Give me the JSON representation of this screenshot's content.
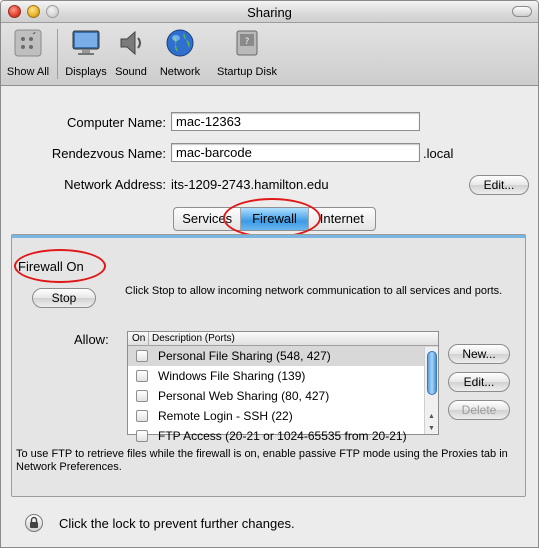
{
  "window": {
    "title": "Sharing"
  },
  "toolbar": {
    "items": [
      {
        "label": "Show All",
        "icon": "apple-icon"
      },
      {
        "label": "Displays",
        "icon": "display-icon"
      },
      {
        "label": "Sound",
        "icon": "speaker-icon"
      },
      {
        "label": "Network",
        "icon": "globe-icon"
      },
      {
        "label": "Startup Disk",
        "icon": "disk-icon"
      }
    ]
  },
  "form": {
    "computer_name_label": "Computer Name:",
    "computer_name_value": "mac-12363",
    "rendezvous_label": "Rendezvous Name:",
    "rendezvous_value": "mac-barcode",
    "rendezvous_suffix": ".local",
    "network_address_label": "Network Address:",
    "network_address_value": "its-1209-2743.hamilton.edu",
    "edit_label": "Edit..."
  },
  "tabs": [
    {
      "label": "Services",
      "selected": false
    },
    {
      "label": "Firewall",
      "selected": true
    },
    {
      "label": "Internet",
      "selected": false
    }
  ],
  "firewall": {
    "status": "Firewall On",
    "stop_label": "Stop",
    "stop_description": "Click Stop to allow incoming network communication to all services and ports.",
    "allow_label": "Allow:",
    "columns": {
      "on": "On",
      "description": "Description (Ports)"
    },
    "rows": [
      {
        "label": "Personal File Sharing (548, 427)",
        "checked": false,
        "selected": true
      },
      {
        "label": "Windows File Sharing (139)",
        "checked": false,
        "selected": false
      },
      {
        "label": "Personal Web Sharing (80, 427)",
        "checked": false,
        "selected": false
      },
      {
        "label": "Remote Login - SSH (22)",
        "checked": false,
        "selected": false
      },
      {
        "label": "FTP Access (20-21 or 1024-65535 from 20-21)",
        "checked": false,
        "selected": false
      }
    ],
    "new_label": "New...",
    "edit_label": "Edit...",
    "delete_label": "Delete",
    "ftp_note": "To use FTP to retrieve files while the firewall is on, enable passive FTP mode using the Proxies tab in Network Preferences."
  },
  "lock": {
    "text": "Click the lock to prevent further changes."
  },
  "colors": {
    "highlight_circle": "#e01818",
    "selected_tab": "#3c9be5"
  }
}
